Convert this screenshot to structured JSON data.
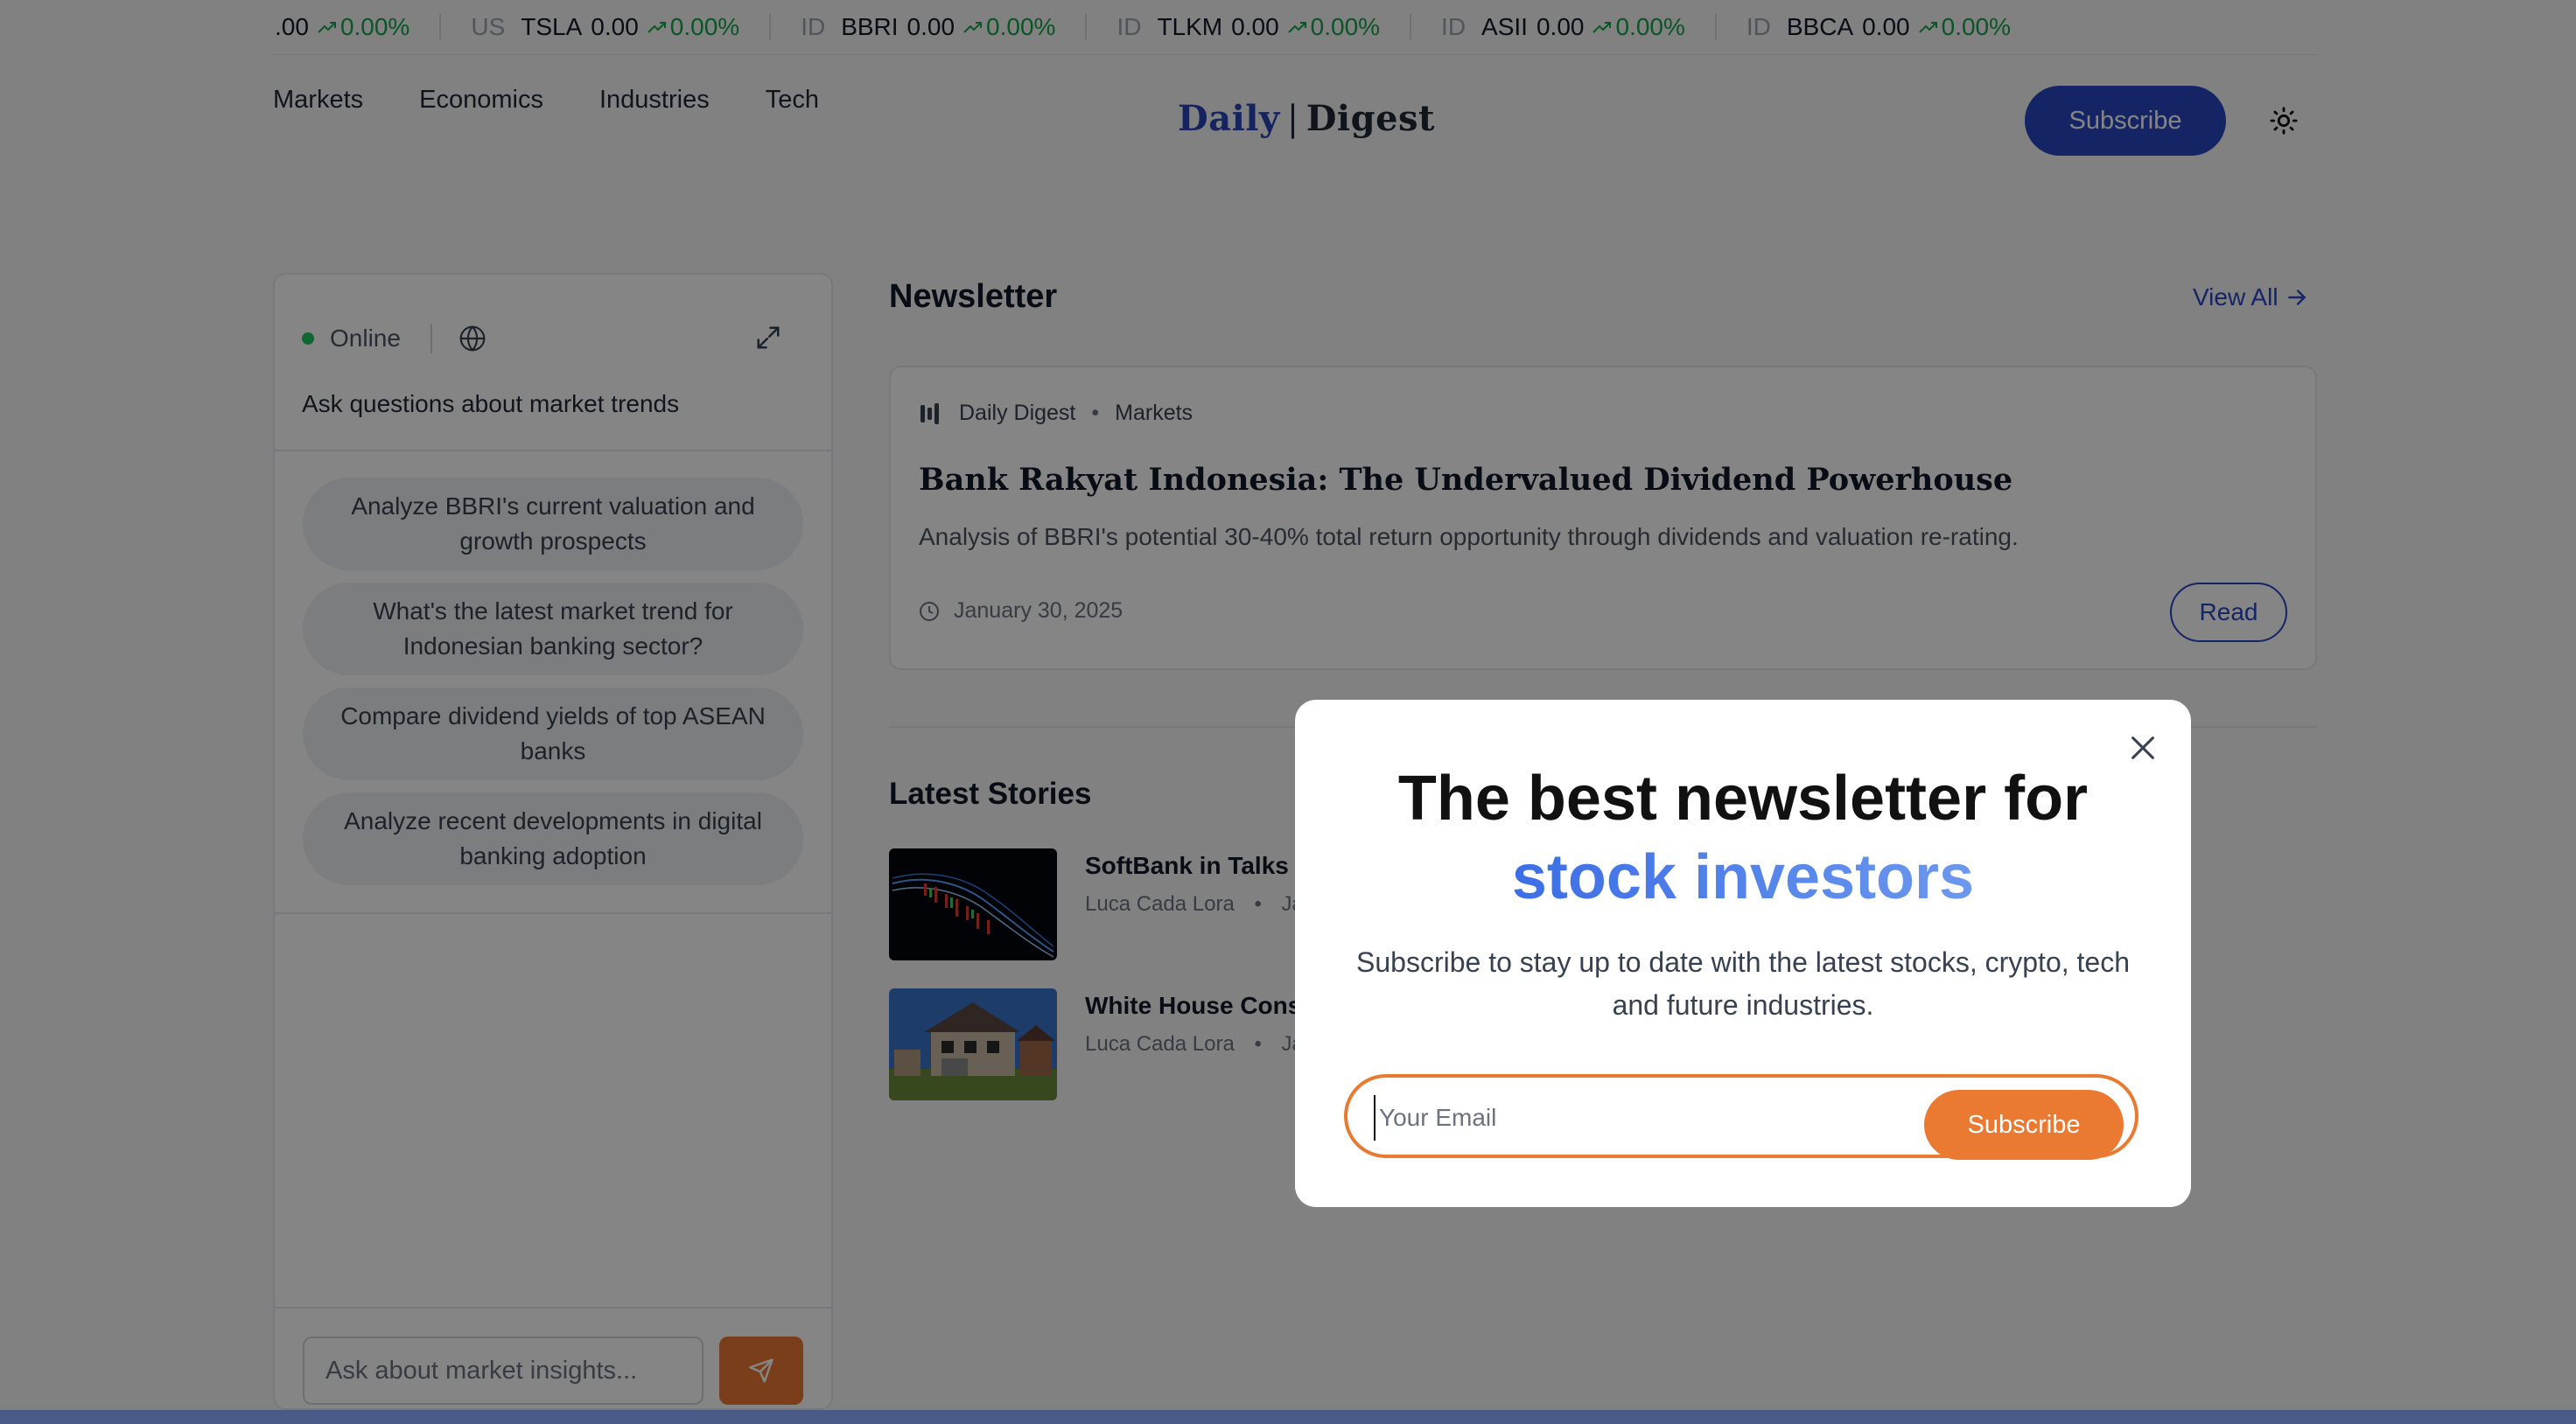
{
  "ticker": [
    {
      "exchange": "",
      "symbol": "",
      "price": ".00",
      "change": "0.00%"
    },
    {
      "exchange": "US",
      "symbol": "TSLA",
      "price": "0.00",
      "change": "0.00%"
    },
    {
      "exchange": "ID",
      "symbol": "BBRI",
      "price": "0.00",
      "change": "0.00%"
    },
    {
      "exchange": "ID",
      "symbol": "TLKM",
      "price": "0.00",
      "change": "0.00%"
    },
    {
      "exchange": "ID",
      "symbol": "ASII",
      "price": "0.00",
      "change": "0.00%"
    },
    {
      "exchange": "ID",
      "symbol": "BBCA",
      "price": "0.00",
      "change": "0.00%"
    }
  ],
  "header": {
    "nav": [
      "Markets",
      "Economics",
      "Industries",
      "Tech"
    ],
    "logo_left": "Daily",
    "logo_sep": "|",
    "logo_right": "Digest",
    "subscribe_label": "Subscribe",
    "theme_icon": "sun-icon"
  },
  "chat": {
    "status": "Online",
    "title": "Ask questions about market trends",
    "suggestions": [
      "Analyze BBRI's current valuation and growth prospects",
      "What's the latest market trend for Indonesian banking sector?",
      "Compare dividend yields of top ASEAN banks",
      "Analyze recent developments in digital banking adoption"
    ],
    "input_placeholder": "Ask about market insights..."
  },
  "newsletter": {
    "section_title": "Newsletter",
    "view_all": "View All",
    "card": {
      "source": "Daily Digest",
      "category": "Markets",
      "title": "Bank Rakyat Indonesia: The Undervalued Dividend Powerhouse",
      "description": "Analysis of BBRI's potential 30-40% total return opportunity through dividends and valuation re-rating.",
      "date": "January 30, 2025",
      "read_label": "Read"
    }
  },
  "latest": {
    "title": "Latest Stories",
    "stories": [
      {
        "title": "SoftBank in Talks t",
        "author": "Luca Cada Lora",
        "date": "Ja"
      },
      {
        "title": "White House Cons",
        "author": "Luca Cada Lora",
        "date": "Ja"
      }
    ]
  },
  "modal": {
    "heading_line1": "The best newsletter for",
    "heading_line2": "stock investors",
    "description": "Subscribe to stay up to date with the latest stocks, crypto, tech and future industries.",
    "email_placeholder": "Your Email",
    "subscribe_label": "Subscribe"
  },
  "colors": {
    "accent_blue": "#2a46c2",
    "accent_orange": "#ea7a32",
    "positive_green": "#16a34a",
    "online_green": "#22c55e"
  }
}
